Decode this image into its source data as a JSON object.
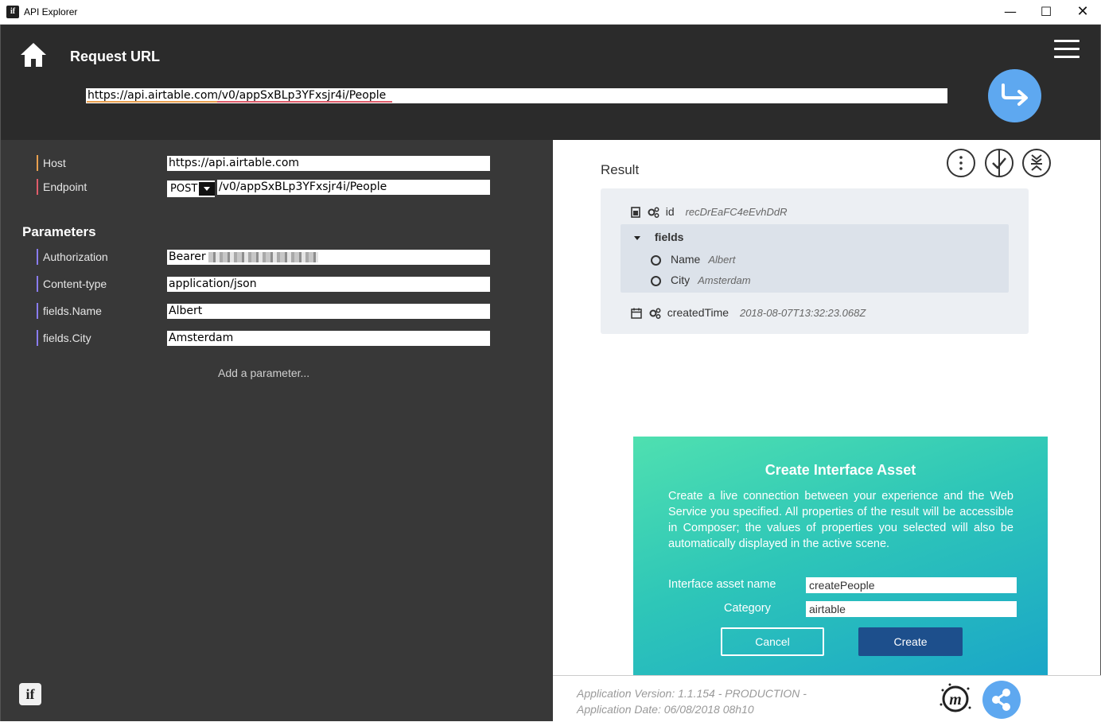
{
  "window": {
    "title": "API Explorer",
    "app_icon": "if",
    "minimize": "—",
    "maximize": "☐",
    "close": "✕"
  },
  "header": {
    "title": "Request URL",
    "url": "https://api.airtable.com/v0/appSxBLp3YFxsjr4i/People",
    "colors": {
      "background": "#2b2b2b",
      "send_button": "#5ea8f0"
    }
  },
  "request": {
    "host_label": "Host",
    "host_value": "https://api.airtable.com",
    "endpoint_label": "Endpoint",
    "method": "POST",
    "endpoint_value": "/v0/appSxBLp3YFxsjr4i/People"
  },
  "parameters": {
    "title": "Parameters",
    "items": [
      {
        "name": "Authorization",
        "value": "Bearer"
      },
      {
        "name": "Content-type",
        "value": "application/json"
      },
      {
        "name": "fields.Name",
        "value": "Albert"
      },
      {
        "name": "fields.City",
        "value": "Amsterdam"
      }
    ],
    "add_label": "Add a parameter..."
  },
  "result": {
    "title": "Result",
    "id_key": "id",
    "id_value": "recDrEaFC4eEvhDdR",
    "fields_key": "fields",
    "fields": [
      {
        "key": "Name",
        "value": "Albert"
      },
      {
        "key": "City",
        "value": "Amsterdam"
      }
    ],
    "created_key": "createdTime",
    "created_value": "2018-08-07T13:32:23.068Z"
  },
  "dialog": {
    "title": "Create Interface Asset",
    "description": "Create a live connection between your experience and the Web Service you specified. All properties of the result will be accessible in Composer; the values of properties you selected will also be automatically displayed in the active scene.",
    "name_label": "Interface asset name",
    "name_value": "createPeople",
    "category_label": "Category",
    "category_value": "airtable",
    "cancel_label": "Cancel",
    "create_label": "Create"
  },
  "footer": {
    "version_line": "Application Version: 1.1.154 - PRODUCTION -",
    "date_line": "Application Date: 06/08/2018 08h10"
  },
  "left_logo": "if"
}
